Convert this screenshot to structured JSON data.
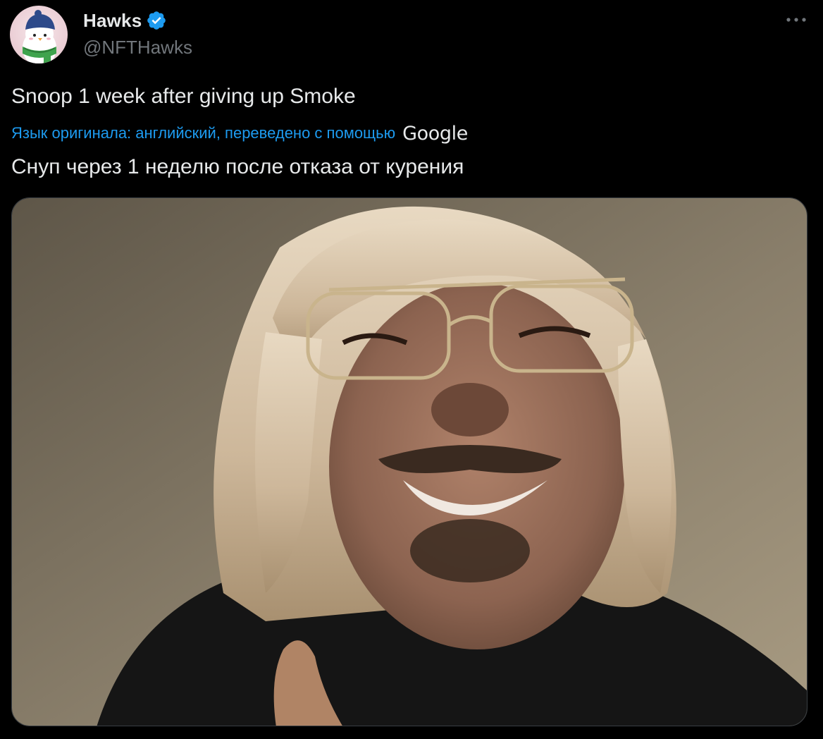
{
  "author": {
    "display_name": "Hawks",
    "handle": "@NFTHawks",
    "avatar_icon": "penguin-avatar-icon",
    "verified_icon": "verified-badge-icon"
  },
  "tweet": {
    "text": "Snoop 1 week after giving up Smoke",
    "translation_note": "Язык оригинала: английский, переведено с помощью",
    "translation_provider": "Google",
    "translated_text": "Снуп через 1 неделю после отказа от курения"
  },
  "media": {
    "icon": "photo-image"
  },
  "menu": {
    "icon": "more-dots-icon"
  },
  "colors": {
    "background": "#000000",
    "text_primary": "#e7e9ea",
    "text_secondary": "#71767b",
    "accent": "#1d9bf0"
  }
}
